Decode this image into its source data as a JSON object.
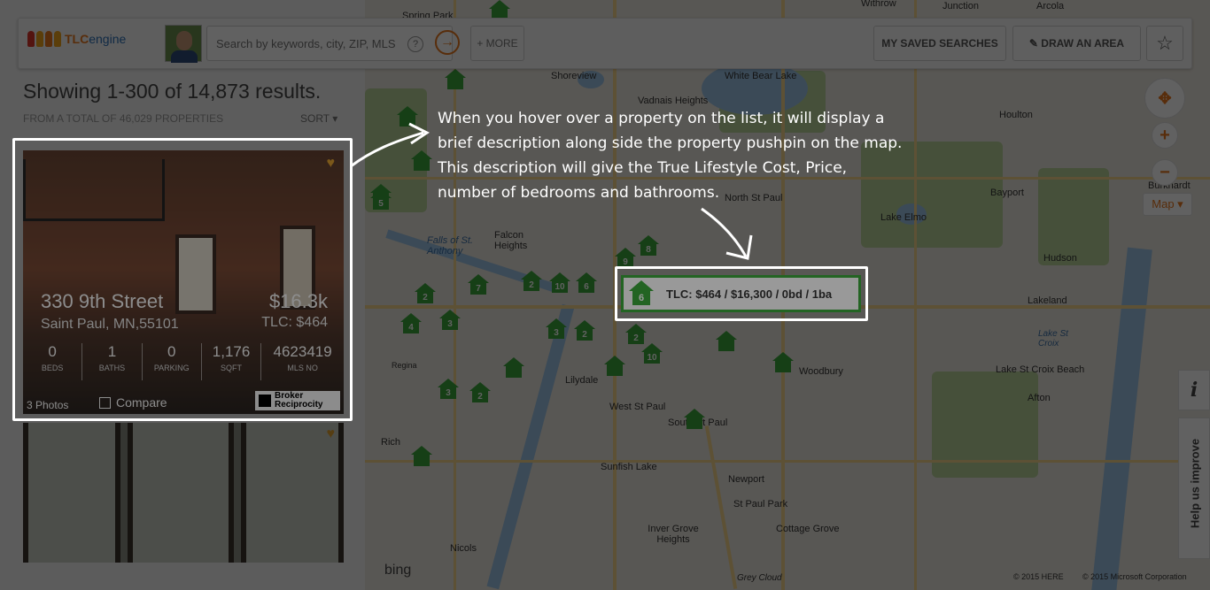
{
  "header": {
    "logo_text_main": "TLC",
    "logo_text_engine": "engine",
    "search_placeholder": "Search by keywords, city, ZIP, MLS",
    "more_label": "+ MORE",
    "saved_searches_label": "MY SAVED SEARCHES",
    "draw_area_label": "DRAW AN AREA"
  },
  "results": {
    "showing": "Showing 1-300 of 14,873 results.",
    "from_total": "FROM A TOTAL OF 46,029 PROPERTIES",
    "sort_label": "SORT ▾"
  },
  "listing": {
    "street": "330 9th Street",
    "city": "Saint Paul, MN,55101",
    "price": "$16.3k",
    "tlc": "TLC: $464",
    "stats": [
      {
        "value": "0",
        "label": "BEDS"
      },
      {
        "value": "1",
        "label": "BATHS"
      },
      {
        "value": "0",
        "label": "PARKING"
      },
      {
        "value": "1,176",
        "label": "SQFT"
      },
      {
        "value": "4623419",
        "label": "MLS NO"
      }
    ],
    "photos": "3 Photos",
    "compare": "Compare",
    "broker_line1": "Broker",
    "broker_line2": "Reciprocity"
  },
  "annotation": "When you hover over a property on the list, it will display a brief description along side the property pushpin on the map. This description will give the True Lifestyle Cost, Price, number of bedrooms and bathrooms.",
  "tooltip": {
    "pin_count": "6",
    "text": "TLC: $464 / $16,300 / 0bd / 1ba"
  },
  "map": {
    "type_label": "Map ▾",
    "help_label": "Help us improve",
    "info_label": "i",
    "bing": "bing",
    "copyright_here": "© 2015 HERE",
    "copyright_ms": "© 2015 Microsoft Corporation",
    "towns": [
      {
        "name": "Spring Park"
      },
      {
        "name": "Withrow"
      },
      {
        "name": "Junction"
      },
      {
        "name": "Arcola"
      },
      {
        "name": "Shoreview"
      },
      {
        "name": "White Bear Lake"
      },
      {
        "name": "Vadnais Heights"
      },
      {
        "name": "Houlton"
      },
      {
        "name": "North St Paul"
      },
      {
        "name": "Bayport"
      },
      {
        "name": "Burkhardt"
      },
      {
        "name": "Lake Elmo"
      },
      {
        "name": "Falcon Heights"
      },
      {
        "name": "Falls of St. Anthony"
      },
      {
        "name": "Hudson"
      },
      {
        "name": "Lakeland"
      },
      {
        "name": "Lake St Croix"
      },
      {
        "name": "Lilydale"
      },
      {
        "name": "Woodbury"
      },
      {
        "name": "Lake St Croix Beach"
      },
      {
        "name": "Afton"
      },
      {
        "name": "West St Paul"
      },
      {
        "name": "South St Paul"
      },
      {
        "name": "Sunfish Lake"
      },
      {
        "name": "Newport"
      },
      {
        "name": "St Paul Park"
      },
      {
        "name": "Inver Grove Heights"
      },
      {
        "name": "Cottage Grove"
      },
      {
        "name": "Nicols"
      },
      {
        "name": "Rich"
      },
      {
        "name": "Regina"
      },
      {
        "name": "Grey Cloud"
      }
    ],
    "pins": [
      "",
      "",
      "",
      "",
      "5",
      "2",
      "10",
      "6",
      "9",
      "8",
      "4",
      "3",
      "5",
      "3",
      "2",
      "2",
      "2",
      "7",
      "10",
      "3",
      "2",
      "",
      "",
      "",
      "",
      "",
      ""
    ]
  }
}
